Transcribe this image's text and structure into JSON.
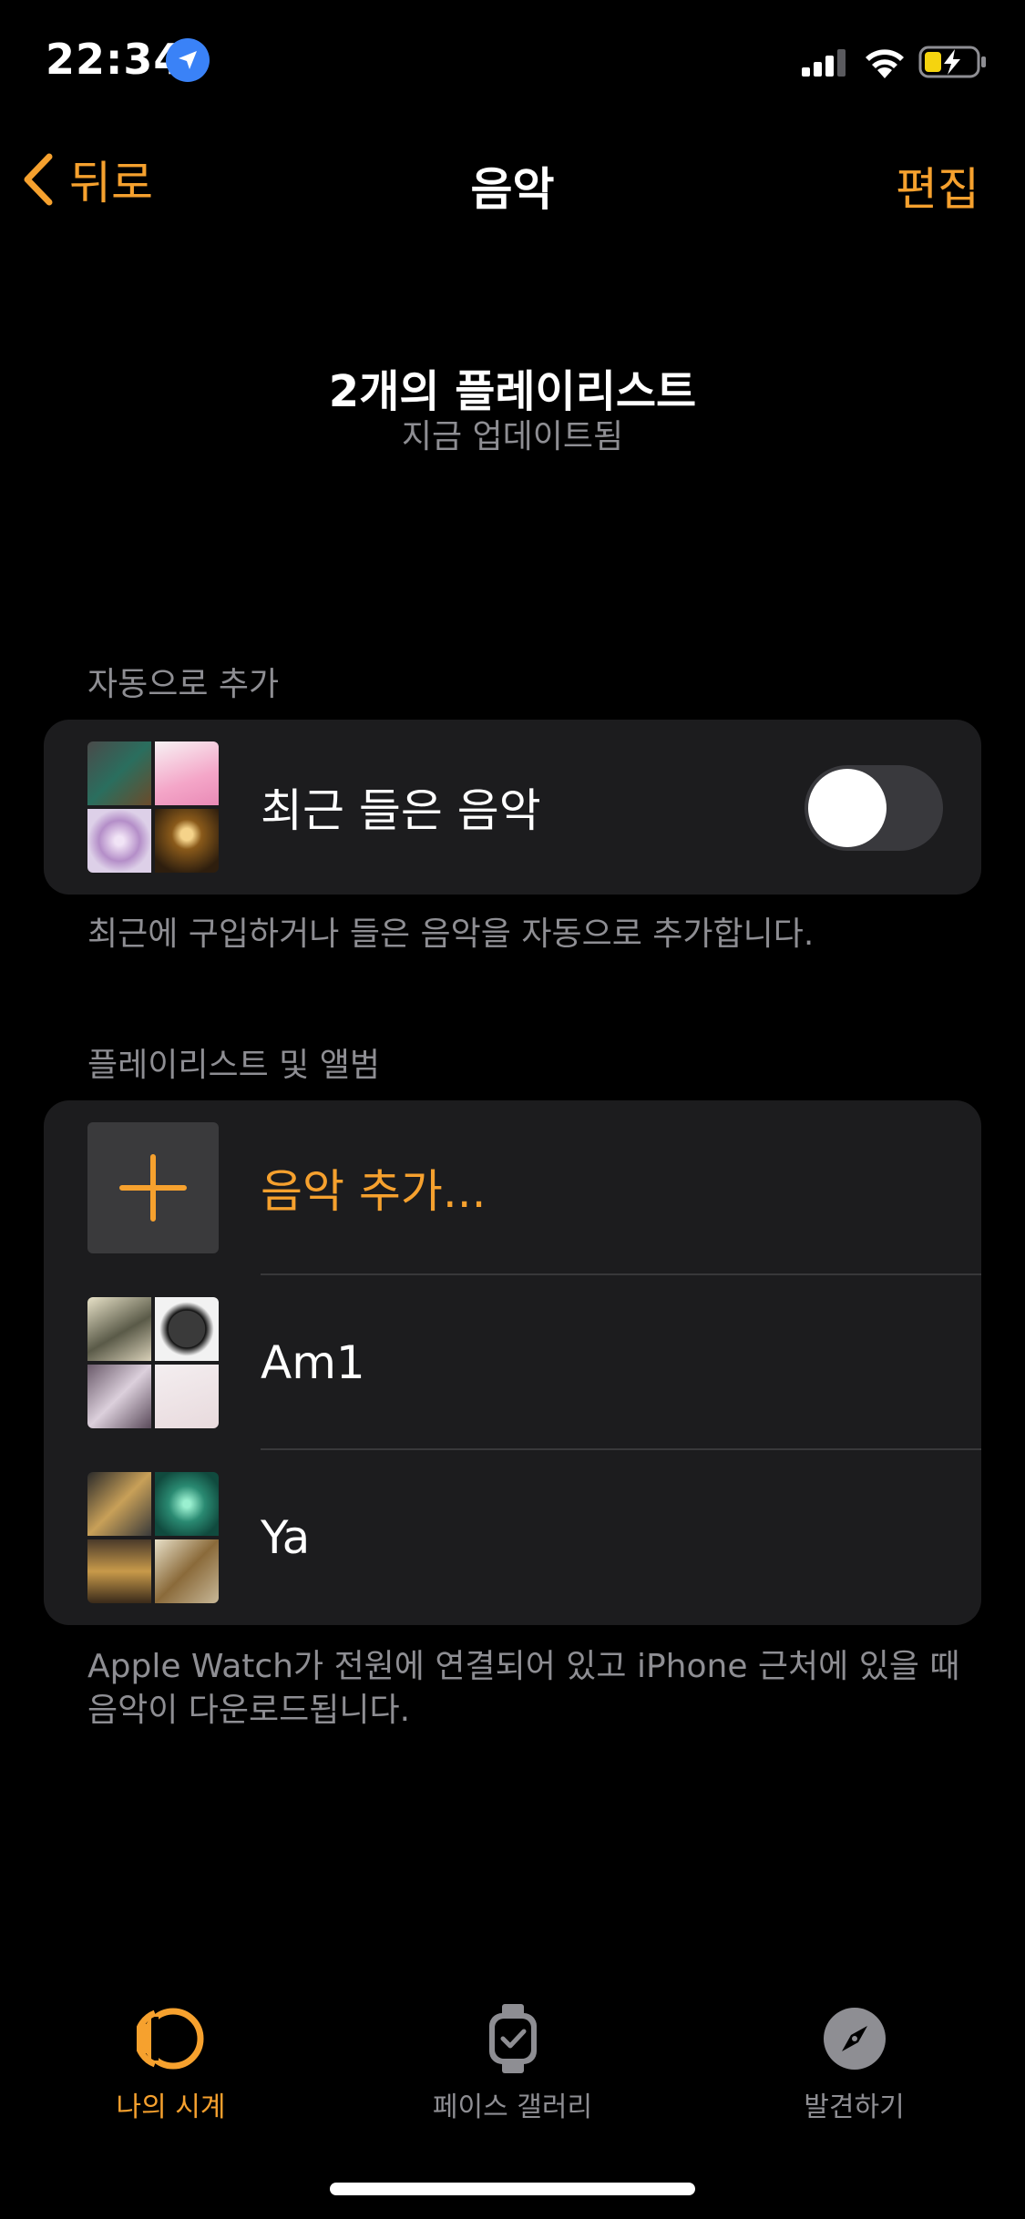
{
  "status_bar": {
    "time": "22:34"
  },
  "nav": {
    "back_label": "뒤로",
    "title": "음악",
    "edit_label": "편집"
  },
  "summary": {
    "title": "2개의 플레이리스트",
    "subtitle": "지금 업데이트됨"
  },
  "auto_section": {
    "header": "자동으로 추가",
    "row_label": "최근 들은 음악",
    "toggle_on": false,
    "footer": "최근에 구입하거나 들은 음악을 자동으로 추가합니다."
  },
  "playlists_section": {
    "header": "플레이리스트 및 앨범",
    "add_label": "음악 추가...",
    "items": [
      {
        "label": "Am1"
      },
      {
        "label": "Ya"
      }
    ],
    "footer": "Apple Watch가 전원에 연결되어 있고 iPhone 근처에 있을 때 음악이 다운로드됩니다."
  },
  "tabs": [
    {
      "label": "나의 시계",
      "icon": "watch-icon",
      "active": true
    },
    {
      "label": "페이스 갤러리",
      "icon": "watch-face-icon",
      "active": false
    },
    {
      "label": "발견하기",
      "icon": "compass-icon",
      "active": false
    }
  ],
  "colors": {
    "accent": "#f6a12e",
    "background": "#000000",
    "card": "#1c1c1e",
    "secondary_text": "#8e8e93"
  }
}
